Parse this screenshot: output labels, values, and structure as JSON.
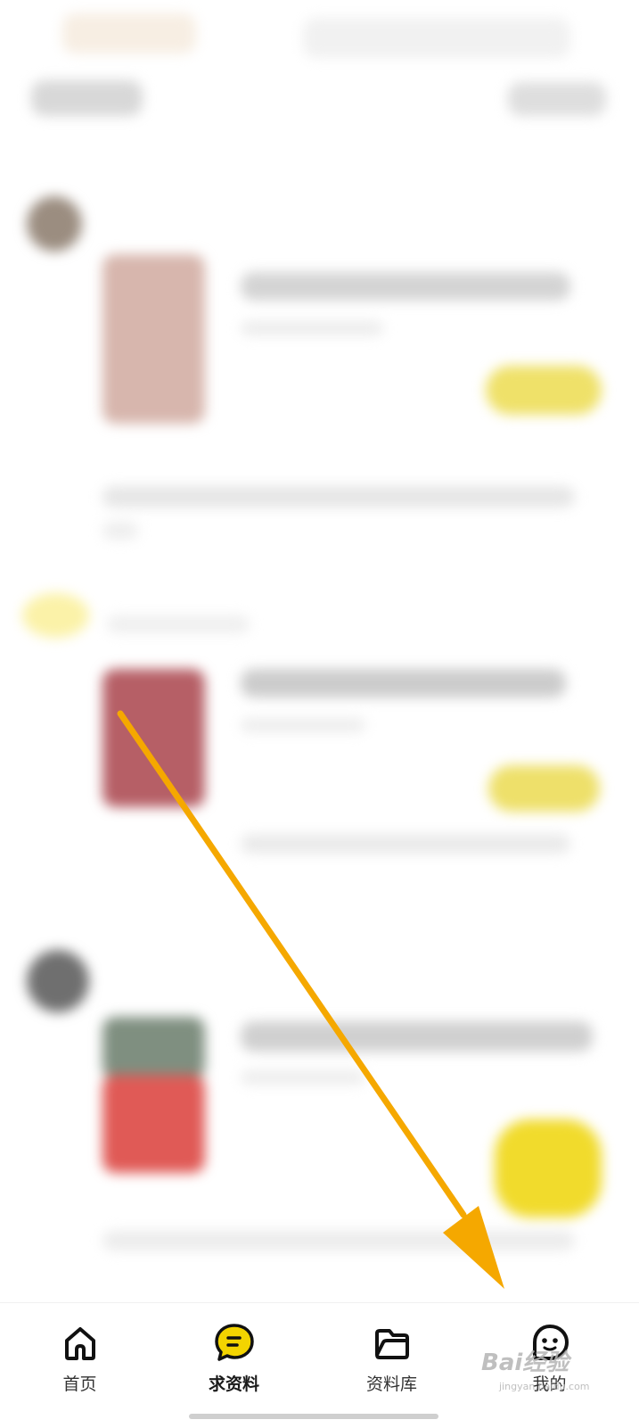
{
  "tabbar": {
    "tabs": [
      {
        "label": "首页",
        "icon": "home-icon"
      },
      {
        "label": "求资料",
        "icon": "chat-bubble-icon",
        "active": true
      },
      {
        "label": "资料库",
        "icon": "folder-icon"
      },
      {
        "label": "我的",
        "icon": "smiley-face-icon"
      }
    ]
  },
  "watermark": {
    "text": "Bai经验",
    "sub": "jingyan.baidu.com"
  },
  "colors": {
    "accent_yellow": "#f3d400",
    "arrow_orange": "#f5a800"
  }
}
